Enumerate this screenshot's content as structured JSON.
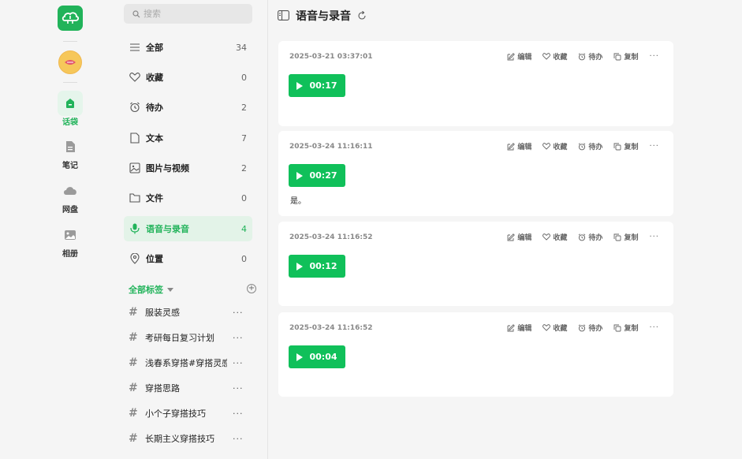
{
  "rail": {
    "items": [
      {
        "label": "话袋"
      },
      {
        "label": "笔记"
      },
      {
        "label": "网盘"
      },
      {
        "label": "相册"
      }
    ]
  },
  "search": {
    "placeholder": "搜索"
  },
  "categories": [
    {
      "label": "全部",
      "count": "34",
      "icon": "list-icon"
    },
    {
      "label": "收藏",
      "count": "0",
      "icon": "heart-icon"
    },
    {
      "label": "待办",
      "count": "2",
      "icon": "alarm-clock-icon"
    },
    {
      "label": "文本",
      "count": "7",
      "icon": "document-icon"
    },
    {
      "label": "图片与视频",
      "count": "2",
      "icon": "image-icon"
    },
    {
      "label": "文件",
      "count": "0",
      "icon": "folder-icon"
    },
    {
      "label": "语音与录音",
      "count": "4",
      "icon": "microphone-icon"
    },
    {
      "label": "位置",
      "count": "0",
      "icon": "location-pin-icon"
    }
  ],
  "tags": {
    "title": "全部标签",
    "items": [
      {
        "name": "服装灵感"
      },
      {
        "name": "考研每日复习计划"
      },
      {
        "name": "浅春系穿搭#穿搭灵感"
      },
      {
        "name": "穿搭思路"
      },
      {
        "name": "小个子穿搭技巧"
      },
      {
        "name": "长期主义穿搭技巧"
      }
    ]
  },
  "header": {
    "title": "语音与录音"
  },
  "actions": {
    "edit": "编辑",
    "fav": "收藏",
    "todo": "待办",
    "copy": "复制"
  },
  "cards": [
    {
      "timestamp": "2025-03-21 03:37:01",
      "duration": "00:17",
      "text": ""
    },
    {
      "timestamp": "2025-03-24 11:16:11",
      "duration": "00:27",
      "text": "是。"
    },
    {
      "timestamp": "2025-03-24 11:16:52",
      "duration": "00:12",
      "text": ""
    },
    {
      "timestamp": "2025-03-24 11:16:52",
      "duration": "00:04",
      "text": ""
    }
  ],
  "colors": {
    "accent": "#21b35a",
    "play_button": "#10c05a"
  }
}
